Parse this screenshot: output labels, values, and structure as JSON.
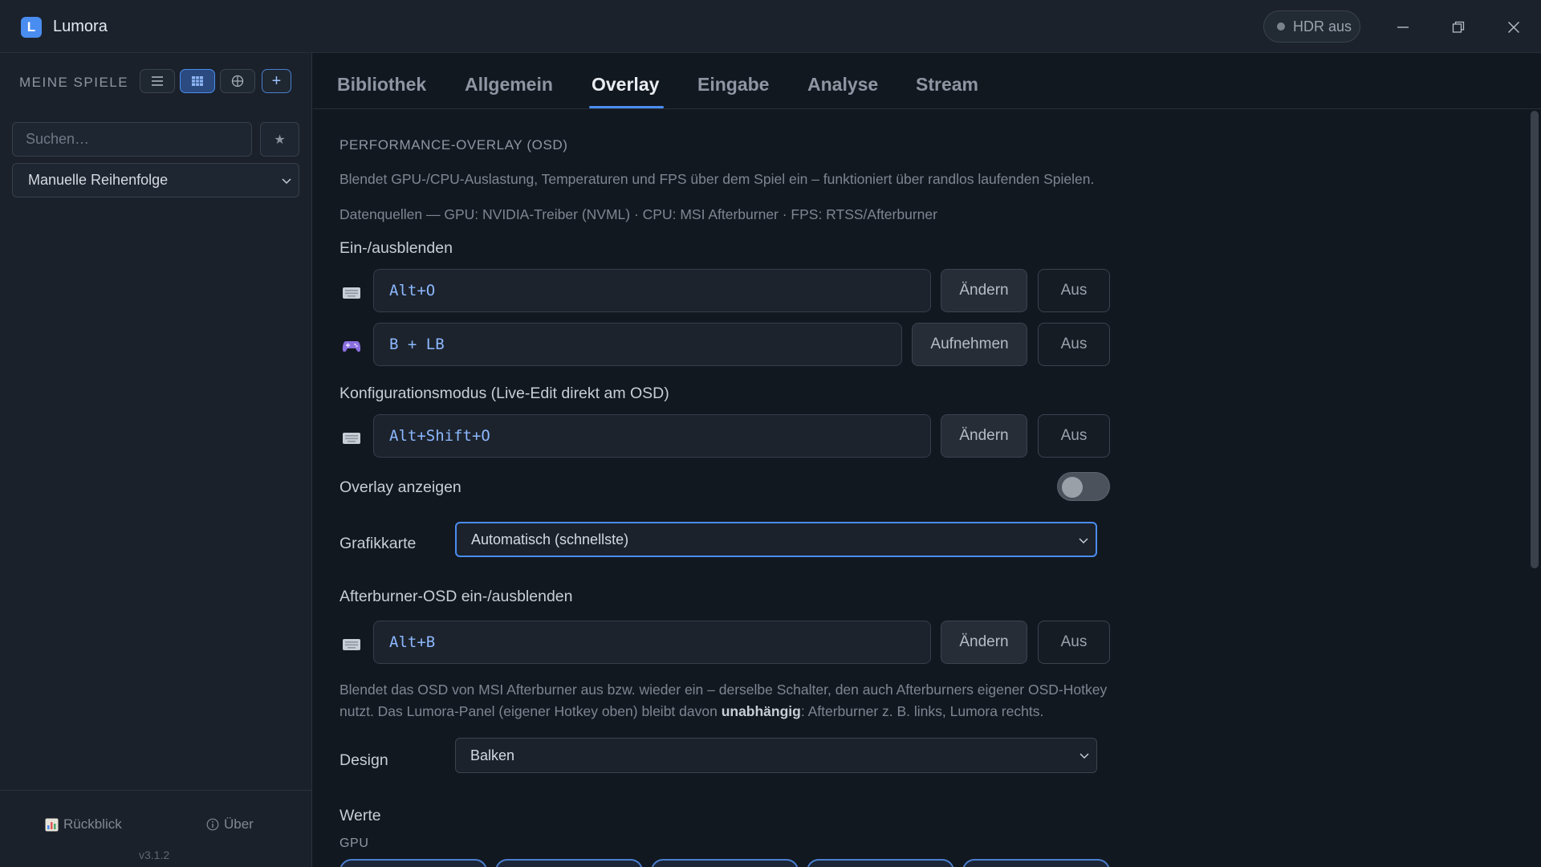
{
  "titlebar": {
    "logo_letter": "L",
    "app_name": "Lumora",
    "hdr_label": "HDR aus"
  },
  "sidebar": {
    "title": "MEINE SPIELE",
    "search_placeholder": "Suchen…",
    "add_label": "+",
    "star_label": "★",
    "sort_value": "Manuelle Reihenfolge",
    "footer": {
      "recap_label": "Rückblick",
      "about_label": "Über",
      "version": "v3.1.2"
    }
  },
  "tabs": [
    {
      "label": "Bibliothek",
      "active": false
    },
    {
      "label": "Allgemein",
      "active": false
    },
    {
      "label": "Overlay",
      "active": true
    },
    {
      "label": "Eingabe",
      "active": false
    },
    {
      "label": "Analyse",
      "active": false
    },
    {
      "label": "Stream",
      "active": false
    }
  ],
  "overlay": {
    "section_title": "PERFORMANCE-OVERLAY (OSD)",
    "description": "Blendet GPU-/CPU-Auslastung, Temperaturen und FPS über dem Spiel ein – funktioniert über randlos laufenden Spielen.",
    "sources": "Datenquellen — GPU: NVIDIA-Treiber (NVML) · CPU: MSI Afterburner · FPS: RTSS/Afterburner",
    "toggle_group": {
      "label": "Ein-/ausblenden",
      "keyboard_hotkey": "Alt+O",
      "keyboard_change": "Ändern",
      "keyboard_off": "Aus",
      "gamepad_hotkey": "B + LB",
      "gamepad_record": "Aufnehmen",
      "gamepad_off": "Aus"
    },
    "config_group": {
      "label": "Konfigurationsmodus (Live-Edit direkt am OSD)",
      "hotkey": "Alt+Shift+O",
      "change": "Ändern",
      "off": "Aus"
    },
    "show_overlay": {
      "label": "Overlay anzeigen",
      "enabled": false
    },
    "gpu_select": {
      "label": "Grafikkarte",
      "value": "Automatisch (schnellste)"
    },
    "afterburner_group": {
      "label": "Afterburner-OSD ein-/ausblenden",
      "hotkey": "Alt+B",
      "change": "Ändern",
      "off": "Aus",
      "note_part1": "Blendet das OSD von MSI Afterburner aus bzw. wieder ein – derselbe Schalter, den auch Afterburners eigener OSD-Hotkey nutzt. Das Lumora-Panel (eigener Hotkey oben) bleibt davon ",
      "note_bold": "unabhängig",
      "note_part2": ": Afterburner z. B. links, Lumora rechts."
    },
    "design_select": {
      "label": "Design",
      "value": "Balken"
    },
    "values": {
      "label": "Werte",
      "gpu_label": "GPU"
    }
  },
  "colors": {
    "accent": "#4a8df0",
    "background": "#121820",
    "hotkey_text": "#8db8ff",
    "gamepad_icon": "#8a6fe0"
  }
}
